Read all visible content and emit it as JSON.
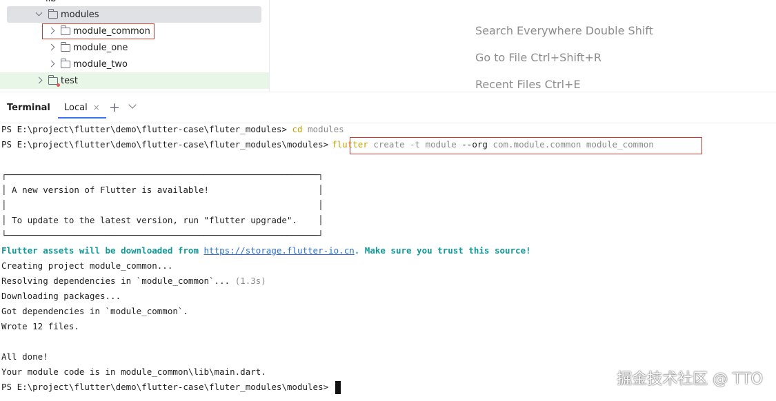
{
  "project_tree": {
    "lib_label": "lib",
    "modules_label": "modules",
    "items": [
      {
        "label": "module_common"
      },
      {
        "label": "module_one"
      },
      {
        "label": "module_two"
      }
    ],
    "test_label": "test"
  },
  "editor_hints": [
    "Search Everywhere Double Shift",
    "Go to File Ctrl+Shift+R",
    "Recent Files Ctrl+E"
  ],
  "terminal_header": {
    "title": "Terminal",
    "tab_label": "Local",
    "close_glyph": "×",
    "add_glyph": "+"
  },
  "terminal": {
    "line1_prompt": "PS E:\\project\\flutter\\demo\\flutter-case\\fluter_modules> ",
    "line1_cmd": "cd",
    "line1_arg": " modules",
    "line2_prompt": "PS E:\\project\\flutter\\demo\\flutter-case\\fluter_modules\\modules>",
    "line2_cmd": "flutter",
    "line2_args1": " create -t module ",
    "line2_flag": "--org",
    "line2_args2": " com.module.common module_common",
    "box_top": "┌────────────────────────────────────────────────────────────┐",
    "box_msg1": "│ A new version of Flutter is available!                     │",
    "box_blank": "│                                                            │",
    "box_msg2": "│ To update to the latest version, run \"flutter upgrade\".    │",
    "box_bottom": "└────────────────────────────────────────────────────────────┘",
    "assets_prefix": "Flutter assets will be downloaded from ",
    "assets_url": "https://storage.flutter-io.cn",
    "assets_suffix": ". Make sure you trust this source!",
    "creating": "Creating project module_common...",
    "resolving": "Resolving dependencies in `module_common`... ",
    "resolving_time": "(1.3s)",
    "downloading": "Downloading packages...",
    "got_deps": "Got dependencies in `module_common`.",
    "wrote": "Wrote 12 files.",
    "all_done": "All done!",
    "module_code": "Your module code is in module_common\\lib\\main.dart.",
    "last_prompt": "PS E:\\project\\flutter\\demo\\flutter-case\\fluter_modules\\modules> "
  },
  "watermark": "掘金技术社区 @ TTO",
  "colors": {
    "highlight_red": "#d9332b",
    "selected_row": "#dfe1e5",
    "test_row": "#e8f6e8",
    "teal": "#119898",
    "link": "#2a6ecf",
    "command_yellow": "#c4a000"
  }
}
